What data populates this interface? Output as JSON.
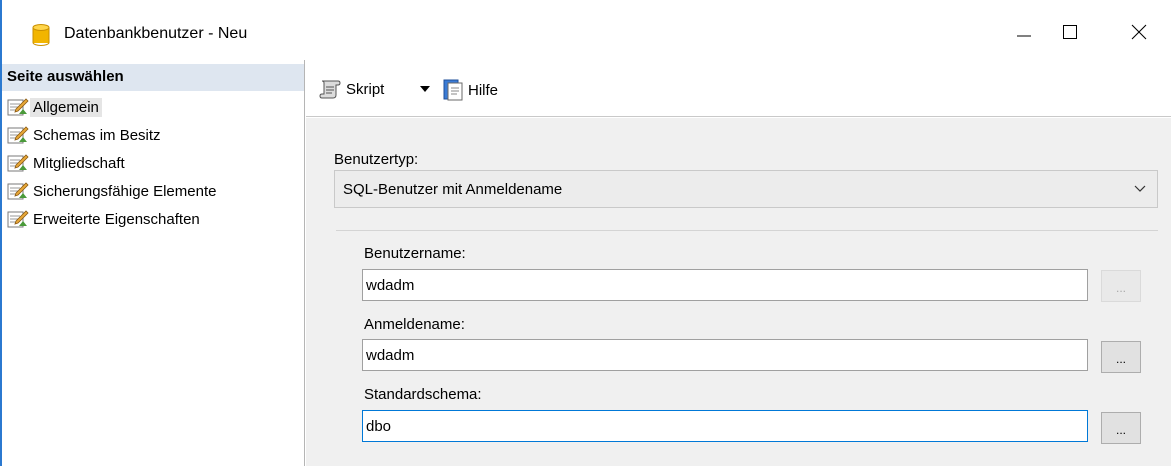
{
  "window": {
    "title": "Datenbankbenutzer - Neu",
    "controls": {
      "minimize": "—",
      "maximize": "□",
      "close": "✕"
    }
  },
  "sidebar": {
    "header": "Seite auswählen",
    "items": [
      {
        "label": "Allgemein",
        "selected": true,
        "icon": "page-properties-icon"
      },
      {
        "label": "Schemas im Besitz",
        "selected": false,
        "icon": "page-properties-icon"
      },
      {
        "label": "Mitgliedschaft",
        "selected": false,
        "icon": "page-properties-icon"
      },
      {
        "label": "Sicherungsfähige Elemente",
        "selected": false,
        "icon": "page-properties-icon"
      },
      {
        "label": "Erweiterte Eigenschaften",
        "selected": false,
        "icon": "page-properties-icon"
      }
    ]
  },
  "toolbar": {
    "script_label": "Skript",
    "help_label": "Hilfe"
  },
  "form": {
    "user_type_label": "Benutzertyp:",
    "user_type_value": "SQL-Benutzer mit Anmeldename",
    "username_label": "Benutzername:",
    "username_value": "wdadm",
    "login_label": "Anmeldename:",
    "login_value": "wdadm",
    "schema_label": "Standardschema:",
    "schema_value": "dbo",
    "browse_label": "..."
  },
  "colors": {
    "accent": "#0078d7",
    "sidebar_header_bg": "#dee6f0",
    "panel_bg": "#f0f0f0",
    "database_icon": "#f2b500"
  }
}
